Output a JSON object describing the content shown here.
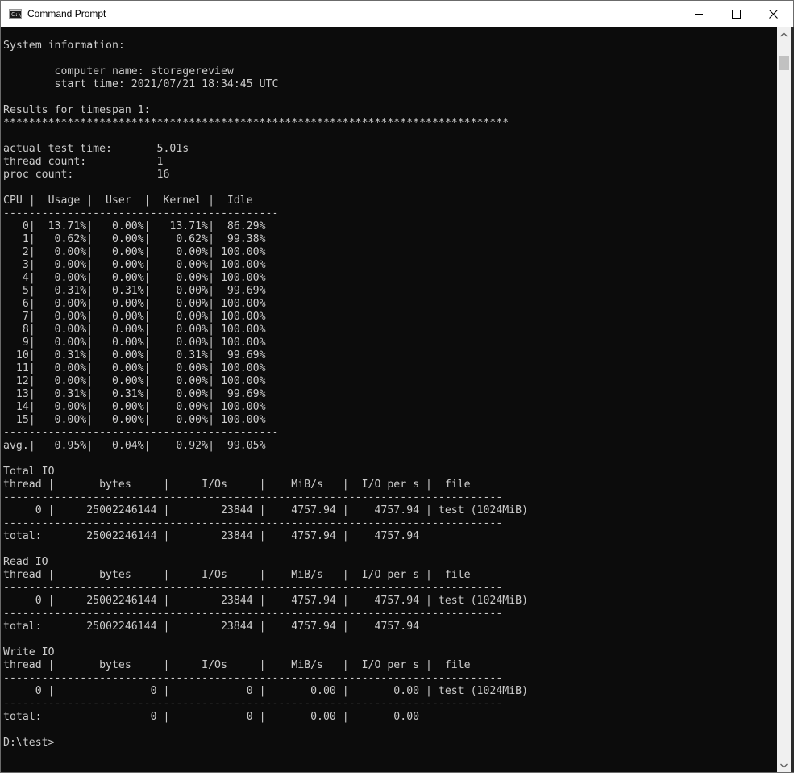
{
  "window": {
    "title": "Command Prompt",
    "icon": "cmd-icon",
    "icon_glyph": "C:\\",
    "minimize_icon": "minimize-icon",
    "maximize_icon": "maximize-icon",
    "close_icon": "close-icon"
  },
  "console": {
    "lines": [
      "System information:",
      "",
      "        computer name: storagereview",
      "        start time: 2021/07/21 18:34:45 UTC",
      "",
      "Results for timespan 1:",
      "*******************************************************************************",
      "",
      "actual test time:       5.01s",
      "thread count:           1",
      "proc count:             16",
      "",
      "CPU |  Usage |  User  |  Kernel |  Idle",
      "-------------------------------------------",
      "   0|  13.71%|   0.00%|   13.71%|  86.29%",
      "   1|   0.62%|   0.00%|    0.62%|  99.38%",
      "   2|   0.00%|   0.00%|    0.00%| 100.00%",
      "   3|   0.00%|   0.00%|    0.00%| 100.00%",
      "   4|   0.00%|   0.00%|    0.00%| 100.00%",
      "   5|   0.31%|   0.31%|    0.00%|  99.69%",
      "   6|   0.00%|   0.00%|    0.00%| 100.00%",
      "   7|   0.00%|   0.00%|    0.00%| 100.00%",
      "   8|   0.00%|   0.00%|    0.00%| 100.00%",
      "   9|   0.00%|   0.00%|    0.00%| 100.00%",
      "  10|   0.31%|   0.00%|    0.31%|  99.69%",
      "  11|   0.00%|   0.00%|    0.00%| 100.00%",
      "  12|   0.00%|   0.00%|    0.00%| 100.00%",
      "  13|   0.31%|   0.31%|    0.00%|  99.69%",
      "  14|   0.00%|   0.00%|    0.00%| 100.00%",
      "  15|   0.00%|   0.00%|    0.00%| 100.00%",
      "-------------------------------------------",
      "avg.|   0.95%|   0.04%|    0.92%|  99.05%",
      "",
      "Total IO",
      "thread |       bytes     |     I/Os     |    MiB/s   |  I/O per s |  file",
      "------------------------------------------------------------------------------",
      "     0 |     25002246144 |        23844 |    4757.94 |    4757.94 | test (1024MiB)",
      "------------------------------------------------------------------------------",
      "total:       25002246144 |        23844 |    4757.94 |    4757.94",
      "",
      "Read IO",
      "thread |       bytes     |     I/Os     |    MiB/s   |  I/O per s |  file",
      "------------------------------------------------------------------------------",
      "     0 |     25002246144 |        23844 |    4757.94 |    4757.94 | test (1024MiB)",
      "------------------------------------------------------------------------------",
      "total:       25002246144 |        23844 |    4757.94 |    4757.94",
      "",
      "Write IO",
      "thread |       bytes     |     I/Os     |    MiB/s   |  I/O per s |  file",
      "------------------------------------------------------------------------------",
      "     0 |               0 |            0 |       0.00 |       0.00 | test (1024MiB)",
      "------------------------------------------------------------------------------",
      "total:                 0 |            0 |       0.00 |       0.00",
      "",
      "D:\\test>"
    ]
  },
  "scrollbar": {
    "up_icon": "scroll-up-arrow-icon",
    "down_icon": "scroll-down-arrow-icon"
  }
}
